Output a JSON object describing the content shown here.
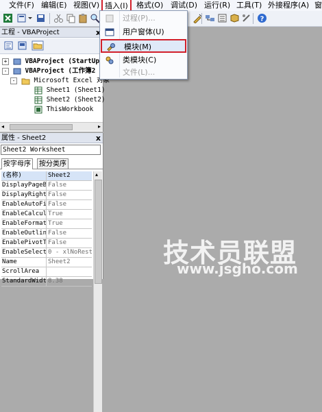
{
  "menubar": {
    "items": [
      {
        "label": "文件(F)"
      },
      {
        "label": "编辑(E)"
      },
      {
        "label": "视图(V)"
      },
      {
        "label": "插入(I)"
      },
      {
        "label": "格式(O)"
      },
      {
        "label": "调试(D)"
      },
      {
        "label": "运行(R)"
      },
      {
        "label": "工具(T)"
      },
      {
        "label": "外接程序(A)"
      },
      {
        "label": "窗"
      }
    ]
  },
  "insert_menu": {
    "items": [
      {
        "label": "过程(P)...",
        "icon": "procedure-icon",
        "enabled": false
      },
      {
        "label": "用户窗体(U)",
        "icon": "userform-icon",
        "enabled": true
      },
      {
        "label": "模块(M)",
        "icon": "module-icon",
        "enabled": true,
        "highlighted": true
      },
      {
        "label": "类模块(C)",
        "icon": "class-module-icon",
        "enabled": true
      },
      {
        "label": "文件(L)...",
        "icon": "",
        "enabled": false
      }
    ]
  },
  "project_pane": {
    "title": "工程 - VBAProject",
    "close": "x",
    "tree": [
      {
        "label": "VBAProject (StartUp"
      },
      {
        "label": "VBAProject (工作簿2"
      },
      {
        "label": "Microsoft Excel 对象"
      },
      {
        "label": "Sheet1 (Sheet1)"
      },
      {
        "label": "Sheet2 (Sheet2)"
      },
      {
        "label": "ThisWorkbook"
      }
    ]
  },
  "properties_pane": {
    "title": "属性 - Sheet2",
    "close": "x",
    "object_selector": "Sheet2 Worksheet",
    "tabs": [
      {
        "label": "按字母序"
      },
      {
        "label": "按分类序"
      }
    ],
    "rows": [
      {
        "name": "(名称)",
        "value": "Sheet2"
      },
      {
        "name": "DisplayPageBr",
        "value": "False"
      },
      {
        "name": "DisplayRightT",
        "value": "False"
      },
      {
        "name": "EnableAutoFil",
        "value": "False"
      },
      {
        "name": "EnableCalcula",
        "value": "True"
      },
      {
        "name": "EnableFormatC",
        "value": "True"
      },
      {
        "name": "EnableOutlini",
        "value": "False"
      },
      {
        "name": "EnablePivotTa",
        "value": "False"
      },
      {
        "name": "EnableSelecti",
        "value": "0 - xlNoRest"
      },
      {
        "name": "Name",
        "value": "Sheet2"
      },
      {
        "name": "ScrollArea",
        "value": ""
      },
      {
        "name": "StandardWidth",
        "value": "8.38"
      }
    ]
  },
  "watermark": {
    "logo": "技术员联盟",
    "url": "www.jsgho.com"
  },
  "colors": {
    "highlight_border": "#d21f2a",
    "workspace": "#ababab",
    "menu_highlight": "#dfe9f8"
  }
}
